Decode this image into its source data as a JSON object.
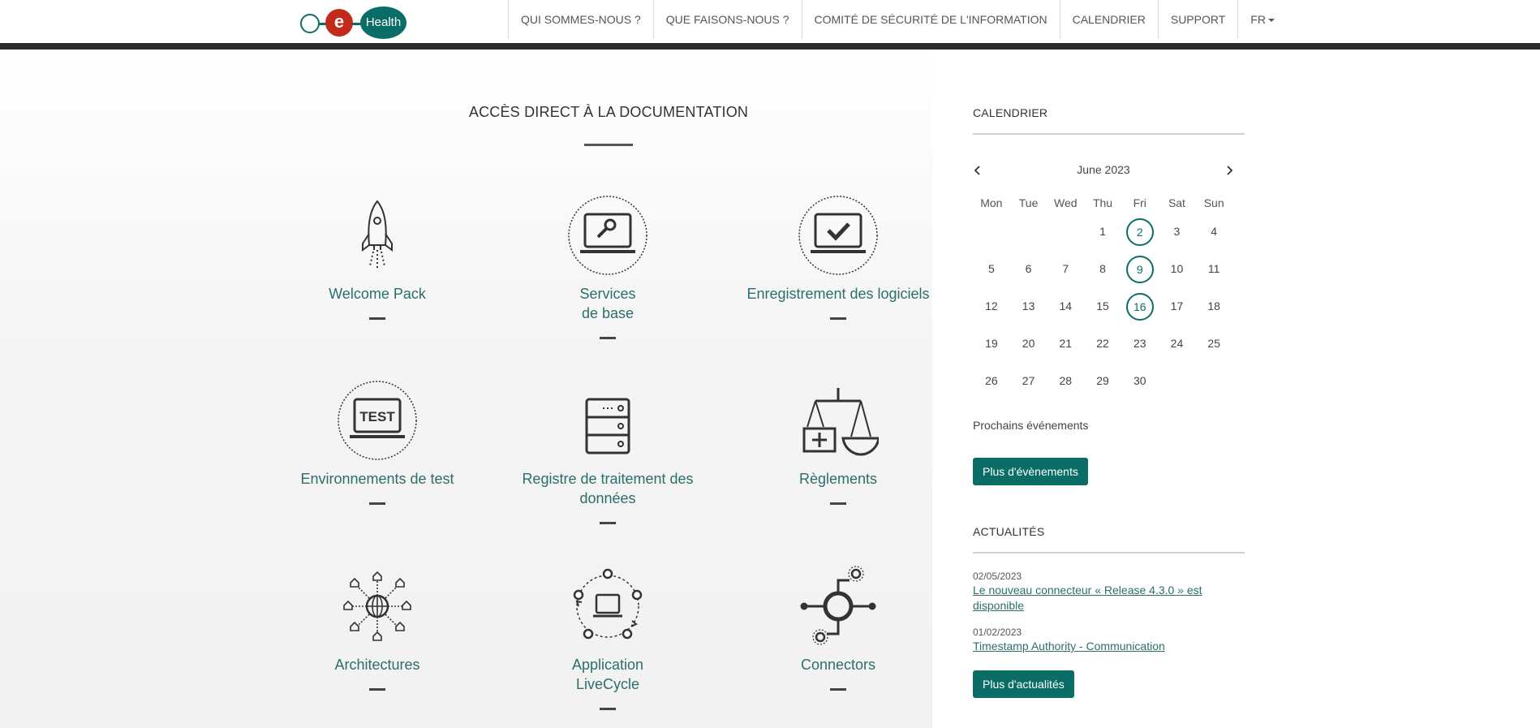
{
  "header": {
    "logo": {
      "e": "e",
      "health": "Health"
    },
    "nav": [
      {
        "label": "QUI SOMMES-NOUS ?"
      },
      {
        "label": "QUE FAISONS-NOUS ?"
      },
      {
        "label": "COMITÉ DE SÉCURITÉ DE L'INFORMATION"
      },
      {
        "label": "CALENDRIER"
      },
      {
        "label": "SUPPORT"
      },
      {
        "label": "FR"
      }
    ]
  },
  "main": {
    "title": "ACCÈS DIRECT À LA DOCUMENTATION",
    "tiles": [
      {
        "line1": "Welcome Pack",
        "line2": "",
        "icon": "rocket-icon"
      },
      {
        "line1": "Services",
        "line2": "de base",
        "icon": "laptop-wrench-icon"
      },
      {
        "line1": "Enregistrement des logiciels",
        "line2": "",
        "icon": "laptop-check-icon"
      },
      {
        "line1": "Environnements de test",
        "line2": "",
        "icon": "laptop-test-icon"
      },
      {
        "line1": "Registre de traitement des",
        "line2": "données",
        "icon": "server-icon"
      },
      {
        "line1": "Règlements",
        "line2": "",
        "icon": "scales-icon"
      },
      {
        "line1": "Architectures",
        "line2": "",
        "icon": "network-globe-icon"
      },
      {
        "line1": "Application",
        "line2": "LiveCycle",
        "icon": "lifecycle-icon"
      },
      {
        "line1": "Connectors",
        "line2": "",
        "icon": "connector-icon"
      }
    ],
    "test_icon_text": "TEST"
  },
  "sidebar": {
    "calendar_heading": "CALENDRIER",
    "month": "June 2023",
    "prev_icon": "chevron-left-icon",
    "next_icon": "chevron-right-icon",
    "weekdays": [
      "Mon",
      "Tue",
      "Wed",
      "Thu",
      "Fri",
      "Sat",
      "Sun"
    ],
    "weeks": [
      [
        "",
        "",
        "",
        "1",
        "2",
        "3",
        "4"
      ],
      [
        "5",
        "6",
        "7",
        "8",
        "9",
        "10",
        "11"
      ],
      [
        "12",
        "13",
        "14",
        "15",
        "16",
        "17",
        "18"
      ],
      [
        "19",
        "20",
        "21",
        "22",
        "23",
        "24",
        "25"
      ],
      [
        "26",
        "27",
        "28",
        "29",
        "30",
        "",
        ""
      ]
    ],
    "event_days": [
      "2",
      "9",
      "16"
    ],
    "upcoming_label": "Prochains événements",
    "more_events_button": "Plus d'évènements",
    "news_heading": "ACTUALITÉS",
    "news": [
      {
        "date": "02/05/2023",
        "title": "Le nouveau connecteur « Release 4.3.0 » est disponible"
      },
      {
        "date": "01/02/2023",
        "title": "Timestamp Authority - Communication"
      }
    ],
    "more_news_button": "Plus d'actualités"
  },
  "colors": {
    "brand_teal": "#0a6e67",
    "brand_red": "#c22a1a",
    "link_teal": "#2b6e6a",
    "header_bar": "#2b2b2b"
  }
}
